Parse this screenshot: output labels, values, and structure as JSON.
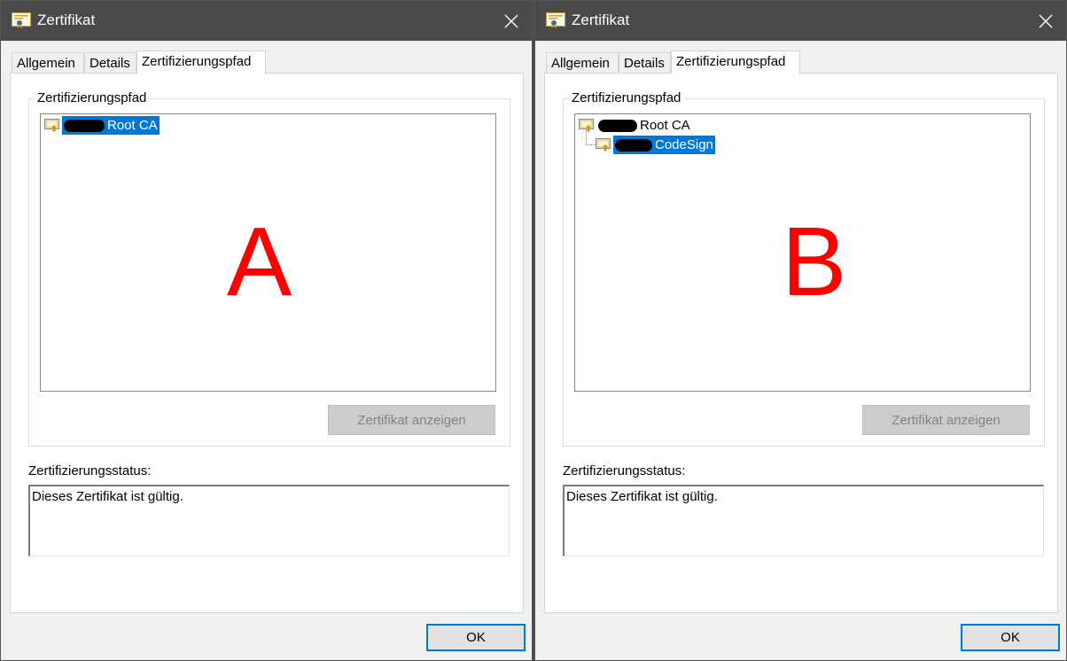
{
  "dialogs": [
    {
      "title": "Zertifikat",
      "tabs": [
        "Allgemein",
        "Details",
        "Zertifizierungspfad"
      ],
      "active_tab": "Zertifizierungspfad",
      "group_label": "Zertifizierungspfad",
      "tree": [
        {
          "label": "Root CA",
          "selected": true
        }
      ],
      "overlay_letter": "A",
      "view_button": "Zertifikat anzeigen",
      "status_label": "Zertifizierungsstatus:",
      "status_text": "Dieses Zertifikat ist gültig.",
      "ok_button": "OK"
    },
    {
      "title": "Zertifikat",
      "tabs": [
        "Allgemein",
        "Details",
        "Zertifizierungspfad"
      ],
      "active_tab": "Zertifizierungspfad",
      "group_label": "Zertifizierungspfad",
      "tree": [
        {
          "label": "Root CA",
          "selected": false
        },
        {
          "label": "CodeSign",
          "selected": true
        }
      ],
      "overlay_letter": "B",
      "view_button": "Zertifikat anzeigen",
      "status_label": "Zertifizierungsstatus:",
      "status_text": "Dieses Zertifikat ist gültig.",
      "ok_button": "OK"
    }
  ],
  "colors": {
    "titlebar": "#4a4a4a",
    "selection": "#0078d7",
    "overlay_letter": "#ff0000",
    "disabled_button": "#cccccc"
  },
  "icons": {
    "title_icon": "certificate-icon",
    "close": "close-icon",
    "tree_node": "certificate-icon"
  }
}
